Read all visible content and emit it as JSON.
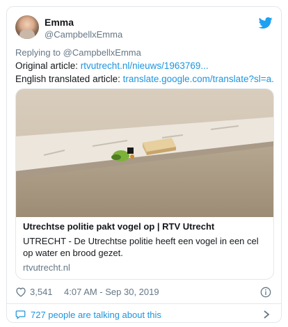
{
  "tweet": {
    "author": {
      "name": "Emma",
      "handle": "@CampbellxEmma"
    },
    "reply_prefix": "Replying to",
    "reply_to": "@CampbellxEmma",
    "original_label": "Original article:",
    "original_link": "rtvutrecht.nl/nieuws/1963769...",
    "translated_label": "English translated article:",
    "translated_link": "translate.google.com/translate?sl=a...",
    "card": {
      "title": "Utrechtse politie pakt vogel op | RTV Utrecht",
      "description": "UTRECHT - De Utrechtse politie heeft een vogel in een cel op water en brood gezet.",
      "domain": "rtvutrecht.nl"
    },
    "likes": "3,541",
    "timestamp": "4:07 AM - Sep 30, 2019",
    "talking": "727 people are talking about this",
    "icons": {
      "brand": "twitter-bird-icon",
      "like": "heart-icon",
      "info": "info-icon",
      "conversation": "speech-bubble-icon",
      "more": "chevron-right-icon"
    },
    "colors": {
      "link": "#1b95e0",
      "muted": "#657786",
      "text": "#14171a",
      "border": "#e1e8ed"
    }
  }
}
